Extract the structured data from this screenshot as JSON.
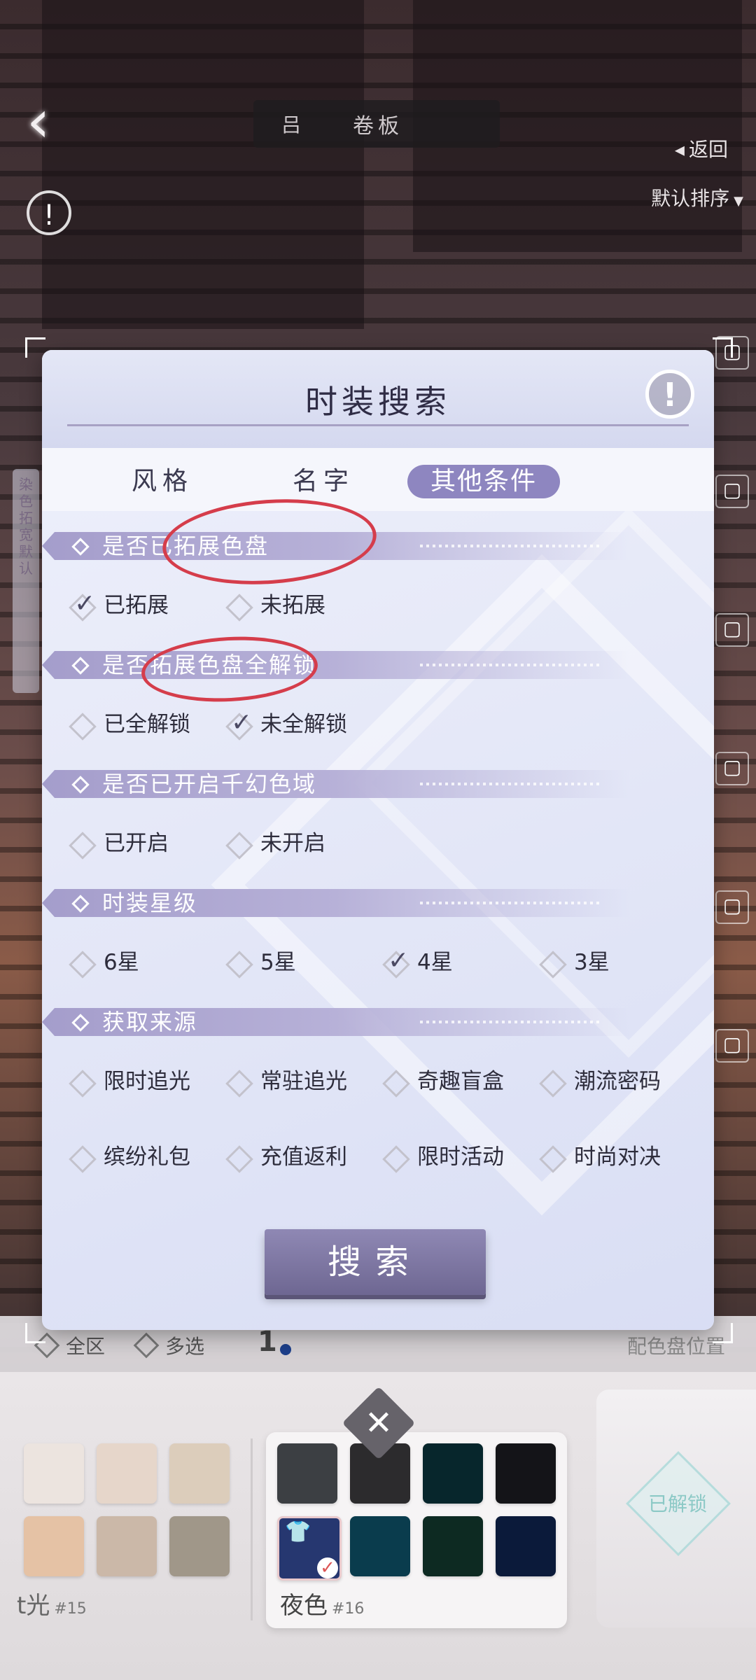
{
  "background": {
    "top_pill": {
      "icon": "吕",
      "text": "卷板"
    },
    "return_label": "返回",
    "sort_label": "默认排序",
    "side_strip_text": "染色拓宽\n默认"
  },
  "modal": {
    "title": "时装搜索",
    "tabs": [
      {
        "label": "风格",
        "active": false
      },
      {
        "label": "名字",
        "active": false
      },
      {
        "label": "其他条件",
        "active": true
      }
    ],
    "sections": [
      {
        "title": "是否已拓展色盘",
        "options": [
          {
            "label": "已拓展",
            "checked": true
          },
          {
            "label": "未拓展",
            "checked": false
          }
        ]
      },
      {
        "title": "是否拓展色盘全解锁",
        "options": [
          {
            "label": "已全解锁",
            "checked": false
          },
          {
            "label": "未全解锁",
            "checked": true
          }
        ]
      },
      {
        "title": "是否已开启千幻色域",
        "options": [
          {
            "label": "已开启",
            "checked": false
          },
          {
            "label": "未开启",
            "checked": false
          }
        ]
      },
      {
        "title": "时装星级",
        "options": [
          {
            "label": "6星",
            "checked": false
          },
          {
            "label": "5星",
            "checked": false
          },
          {
            "label": "4星",
            "checked": true
          },
          {
            "label": "3星",
            "checked": false
          }
        ]
      },
      {
        "title": "获取来源",
        "options": [
          {
            "label": "限时追光",
            "checked": false
          },
          {
            "label": "常驻追光",
            "checked": false
          },
          {
            "label": "奇趣盲盒",
            "checked": false
          },
          {
            "label": "潮流密码",
            "checked": false
          },
          {
            "label": "缤纷礼包",
            "checked": false
          },
          {
            "label": "充值返利",
            "checked": false
          },
          {
            "label": "限时活动",
            "checked": false
          },
          {
            "label": "时尚对决",
            "checked": false
          }
        ]
      }
    ],
    "search_button": "搜索"
  },
  "filter_row": {
    "all_label": "全区",
    "multi_label": "多选",
    "page": "1",
    "right_label": "配色盘位置"
  },
  "palette": {
    "left_group_label": "t光",
    "left_group_num": "#15",
    "left_swatches": [
      "#ece4df",
      "#e6d6ca",
      "#dccdbb",
      "#e5c2a5",
      "#cbb8a8",
      "#a09789"
    ],
    "right_group_label": "夜色",
    "right_group_num": "#16",
    "right_swatches": [
      "#3c3f43",
      "#2c2b2d",
      "#07262c",
      "#141418",
      "#263770",
      "#0a3c4d",
      "#0d2a22",
      "#0b1a3a"
    ],
    "unlocked_label": "已解锁"
  },
  "colors": {
    "accent": "#8e86c0",
    "annotation": "#d53d4b",
    "section_bar": "#a49dcb"
  }
}
